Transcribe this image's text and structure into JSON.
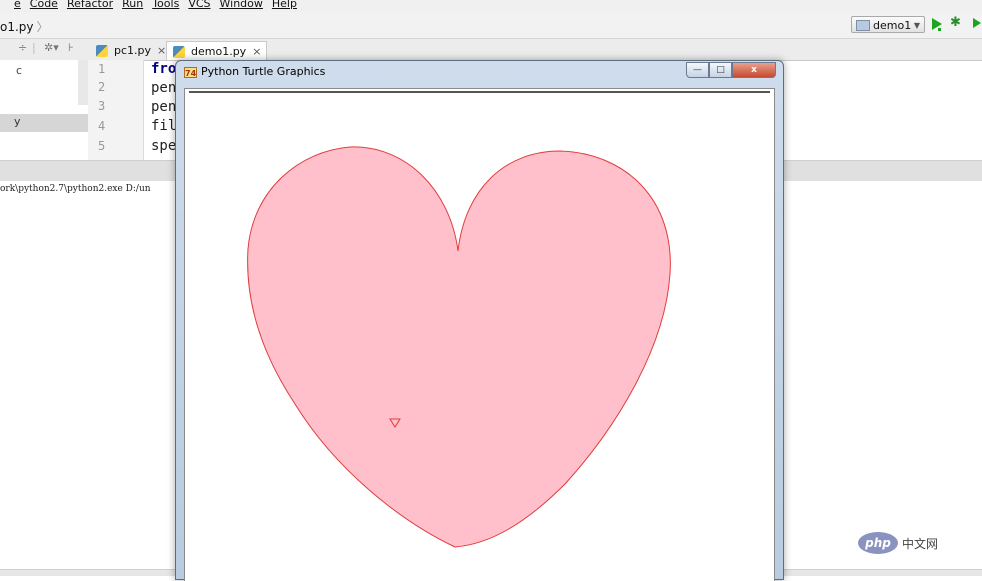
{
  "menu": {
    "items": [
      "e",
      "Code",
      "Refactor",
      "Run",
      "Tools",
      "VCS",
      "Window",
      "Help"
    ]
  },
  "breadcrumb": {
    "file": "o1.py"
  },
  "toolbar": {
    "run_config": "demo1",
    "run_icon": "play-icon",
    "debug_icon": "bug-icon"
  },
  "project_panel": {
    "frag_c": "c",
    "frag_y": "y"
  },
  "tabs": [
    {
      "label": "pc1.py",
      "close": "×"
    },
    {
      "label": "demo1.py",
      "close": "×"
    }
  ],
  "editor": {
    "line_numbers": [
      "1",
      "2",
      "3",
      "4",
      "5"
    ],
    "lines": [
      "fro",
      "pen",
      "pen",
      "fil",
      "spe"
    ]
  },
  "console": {
    "line": "ork\\python2.7\\python2.exe D:/un"
  },
  "turtle_window": {
    "title": "Python Turtle Graphics",
    "icon_text": "74",
    "minimize": "—",
    "maximize": "□",
    "close": "x",
    "heart_fill": "#ffc0cb",
    "heart_stroke": "#e03c3c"
  },
  "watermark": {
    "logo": "php",
    "text": "中文网"
  }
}
